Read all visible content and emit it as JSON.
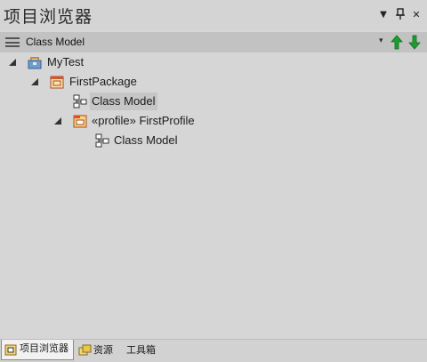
{
  "window": {
    "title": "项目浏览器",
    "dropdown_glyph": "▼",
    "pin_glyph": "ᵖ",
    "close_glyph": "✕"
  },
  "toolbar": {
    "context_label": "Class Model",
    "dropdown_glyph": "▾",
    "up_arrow_color": "#1e9e2e",
    "down_arrow_color": "#1e9e2e"
  },
  "tree": {
    "nodes": [
      {
        "label": "MyTest",
        "icon": "model-root-icon",
        "expanded": true,
        "depth": 0
      },
      {
        "label": "FirstPackage",
        "icon": "package-icon",
        "expanded": true,
        "depth": 1
      },
      {
        "label": "Class Model",
        "icon": "class-diagram-icon",
        "expanded": false,
        "depth": 2,
        "selected": true
      },
      {
        "label": "«profile» FirstProfile",
        "icon": "profile-package-icon",
        "expanded": true,
        "depth": 2
      },
      {
        "label": "Class Model",
        "icon": "class-diagram-icon",
        "expanded": false,
        "depth": 3
      }
    ]
  },
  "tabs": [
    {
      "label": "项目浏览器",
      "icon": "project-browser-icon",
      "active": true
    },
    {
      "label": "资源",
      "icon": "resources-icon",
      "active": false
    },
    {
      "label": "工具箱",
      "icon": "",
      "active": false
    }
  ]
}
